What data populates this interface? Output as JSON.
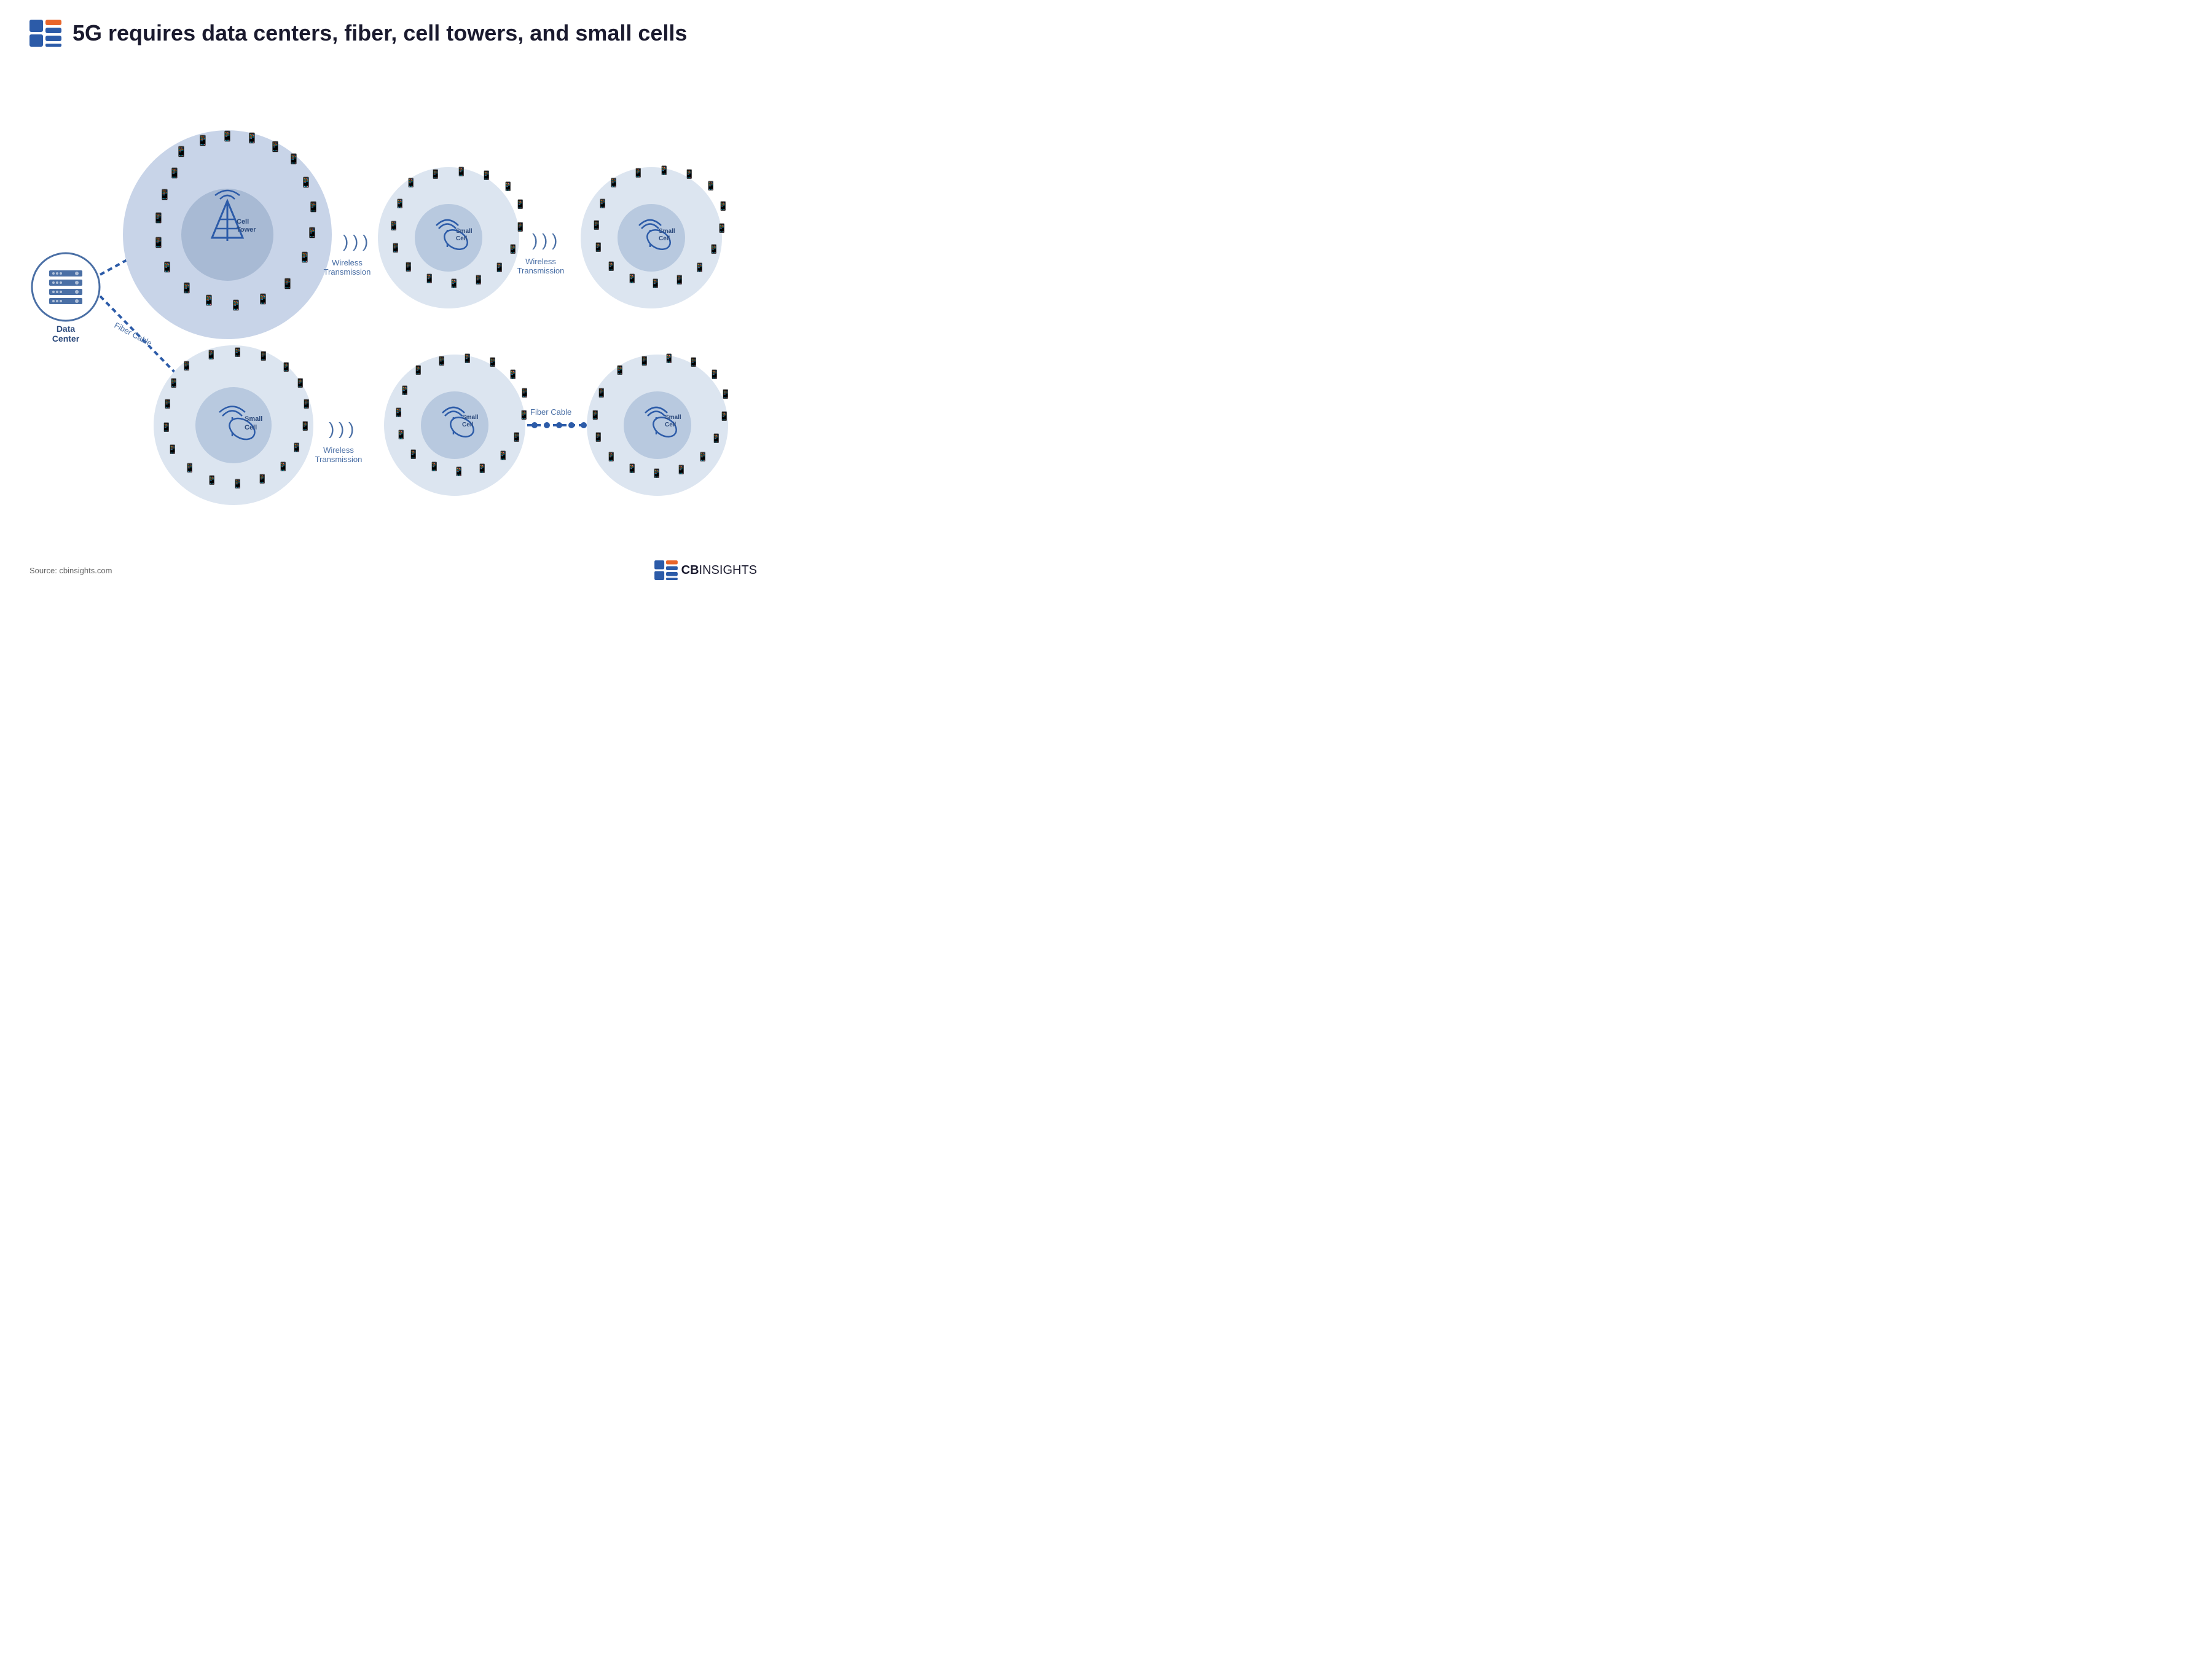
{
  "header": {
    "title": "5G requires data centers, fiber, cell towers, and small cells",
    "logo_alt": "CB Insights Logo"
  },
  "diagram": {
    "data_center": {
      "label": "Data\nCenter"
    },
    "nodes": [
      {
        "id": "cell-tower",
        "type": "large",
        "label": "Cell\nTower",
        "position": "top-left-main"
      },
      {
        "id": "small-cell-top-1",
        "type": "medium",
        "label": "Small\nCell",
        "position": "top-center"
      },
      {
        "id": "small-cell-top-2",
        "type": "medium",
        "label": "Small\nCell",
        "position": "top-right"
      },
      {
        "id": "small-cell-bottom-1",
        "type": "medium",
        "label": "Small\nCell",
        "position": "bottom-left"
      },
      {
        "id": "small-cell-bottom-2",
        "type": "medium",
        "label": "Small\nCell",
        "position": "bottom-center"
      },
      {
        "id": "small-cell-bottom-3",
        "type": "medium",
        "label": "Small\nCell",
        "position": "bottom-right"
      }
    ],
    "connections": [
      {
        "from": "data-center",
        "to": "cell-tower",
        "type": "fiber",
        "label": "Fiber Cable"
      },
      {
        "from": "data-center",
        "to": "small-cell-bottom-1",
        "type": "fiber",
        "label": "Fiber Cable"
      },
      {
        "from": "cell-tower",
        "to": "small-cell-top-1",
        "type": "wireless",
        "label": "Wireless\nTransmission"
      },
      {
        "from": "small-cell-top-1",
        "to": "small-cell-top-2",
        "type": "wireless",
        "label": "Wireless\nTransmission"
      },
      {
        "from": "small-cell-bottom-1",
        "to": "small-cell-bottom-2",
        "type": "wireless",
        "label": "Wireless\nTransmission"
      },
      {
        "from": "small-cell-bottom-2",
        "to": "small-cell-bottom-3",
        "type": "fiber",
        "label": "Fiber Cable"
      }
    ]
  },
  "footer": {
    "source": "Source: cbinsights.com",
    "brand": "CBINSIGHTS"
  }
}
